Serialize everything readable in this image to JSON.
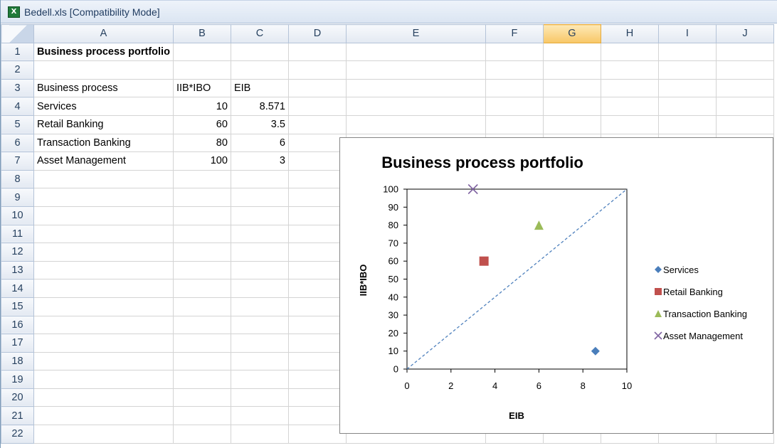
{
  "window": {
    "title": "Bedell.xls  [Compatibility Mode]",
    "icon": "excel-icon"
  },
  "columns": [
    "A",
    "B",
    "C",
    "D",
    "E",
    "F",
    "G",
    "H",
    "I",
    "J"
  ],
  "selected_column": "G",
  "rows": [
    "1",
    "2",
    "3",
    "4",
    "5",
    "6",
    "7",
    "8",
    "9",
    "10",
    "11",
    "12",
    "13",
    "14",
    "15",
    "16",
    "17",
    "18",
    "19",
    "20",
    "21",
    "22"
  ],
  "cells": {
    "a1": "Business process portfolio",
    "a3": "Business process",
    "b3": "IIB*IBO",
    "c3": "EIB",
    "a4": "Services",
    "b4": "10",
    "c4": "8.571",
    "a5": "Retail Banking",
    "b5": "60",
    "c5": "3.5",
    "a6": "Transaction Banking",
    "b6": "80",
    "c6": "6",
    "a7": "Asset Management",
    "b7": "100",
    "c7": "3"
  },
  "chart_data": {
    "type": "scatter",
    "title": "Business process portfolio",
    "xlabel": "EIB",
    "ylabel": "IIB*IBO",
    "xlim": [
      0,
      10
    ],
    "ylim": [
      0,
      100
    ],
    "xticks": [
      "0",
      "2",
      "4",
      "6",
      "8",
      "10"
    ],
    "yticks": [
      "0",
      "10",
      "20",
      "30",
      "40",
      "50",
      "60",
      "70",
      "80",
      "90",
      "100"
    ],
    "grid": false,
    "legend_position": "right",
    "series": [
      {
        "name": "Services",
        "x": 8.571,
        "y": 10,
        "marker": "diamond",
        "color": "#4a7ebb"
      },
      {
        "name": "Retail Banking",
        "x": 3.5,
        "y": 60,
        "marker": "square",
        "color": "#c0504d"
      },
      {
        "name": "Transaction Banking",
        "x": 6,
        "y": 80,
        "marker": "triangle",
        "color": "#9bbb59"
      },
      {
        "name": "Asset Management",
        "x": 3,
        "y": 100,
        "marker": "x",
        "color": "#8064a2"
      }
    ],
    "reference_line": {
      "from": [
        0,
        0
      ],
      "to": [
        10,
        100
      ],
      "style": "dashed",
      "color": "#4f81bd"
    }
  }
}
